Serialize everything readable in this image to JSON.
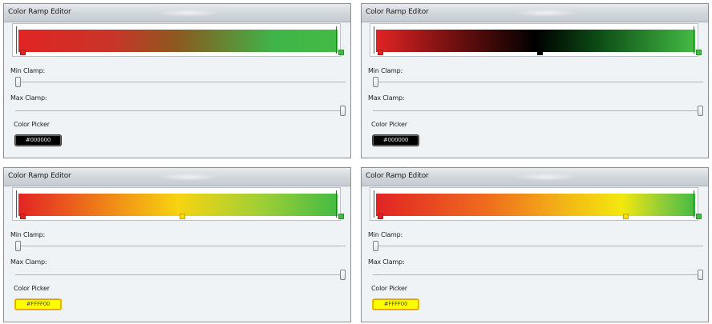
{
  "editors": [
    {
      "title": "Color Ramp Editor",
      "min_clamp_label": "Min Clamp:",
      "max_clamp_label": "Max Clamp:",
      "color_picker_label": "Color Picker",
      "selected_color": "#000000",
      "ramp_gradient": "linear-gradient(to right, #e12424 0%, #c83528 30%, #8b5a20 50%, #3fb449 80%, #44bb44 100%)",
      "stops": [
        {
          "color": "#e12424",
          "position": 0.0
        },
        {
          "color": "#44bb44",
          "position": 1.0
        }
      ],
      "min_clamp": 0.0,
      "max_clamp": 1.0
    },
    {
      "title": "Color Ramp Editor",
      "min_clamp_label": "Min Clamp:",
      "max_clamp_label": "Max Clamp:",
      "color_picker_label": "Color Picker",
      "selected_color": "#000000",
      "ramp_gradient": "linear-gradient(to right, #e12424 0%, #6e0f0f 25%, #000000 50%, #0d4d16 70%, #44bb44 100%)",
      "stops": [
        {
          "color": "#e12424",
          "position": 0.0
        },
        {
          "color": "#000000",
          "position": 0.5
        },
        {
          "color": "#44bb44",
          "position": 1.0
        }
      ],
      "min_clamp": 0.0,
      "max_clamp": 1.0
    },
    {
      "title": "Color Ramp Editor",
      "min_clamp_label": "Min Clamp:",
      "max_clamp_label": "Max Clamp:",
      "color_picker_label": "Color Picker",
      "selected_color": "#FFFF00",
      "ramp_gradient": "linear-gradient(to right, #e12424 0%, #ef7b1a 25%, #f7d410 50%, #a3cf36 75%, #44bb44 100%)",
      "stops": [
        {
          "color": "#e12424",
          "position": 0.0
        },
        {
          "color": "#ffdd00",
          "position": 0.5
        },
        {
          "color": "#44bb44",
          "position": 1.0
        }
      ],
      "min_clamp": 0.0,
      "max_clamp": 1.0
    },
    {
      "title": "Color Ramp Editor",
      "min_clamp_label": "Min Clamp:",
      "max_clamp_label": "Max Clamp:",
      "color_picker_label": "Color Picker",
      "selected_color": "#FFFF00",
      "ramp_gradient": "linear-gradient(to right, #e12424 0%, #ef6d1e 35%, #f3b816 60%, #f3e80e 77%, #8fcc38 90%, #44bb44 100%)",
      "stops": [
        {
          "color": "#e12424",
          "position": 0.0
        },
        {
          "color": "#ffdd00",
          "position": 0.77
        },
        {
          "color": "#44bb44",
          "position": 1.0
        }
      ],
      "min_clamp": 0.0,
      "max_clamp": 1.0
    }
  ]
}
